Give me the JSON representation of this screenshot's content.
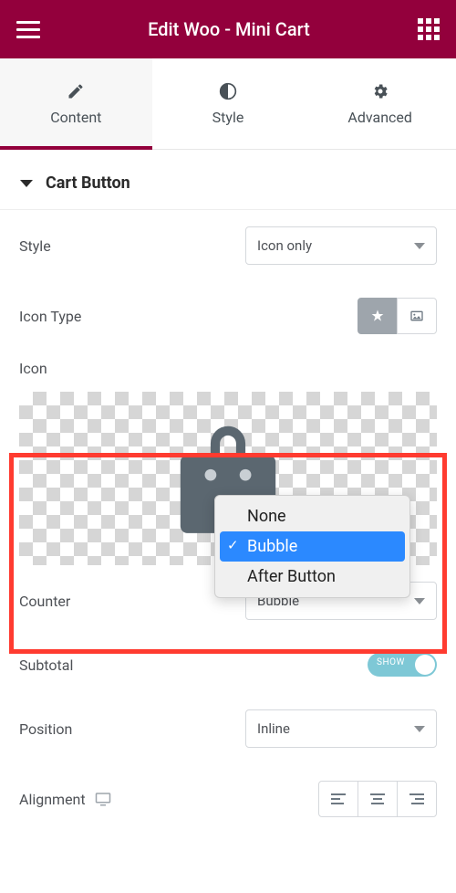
{
  "header": {
    "title": "Edit Woo - Mini Cart"
  },
  "tabs": {
    "content": "Content",
    "style": "Style",
    "advanced": "Advanced",
    "active": "content"
  },
  "section": {
    "title": "Cart Button"
  },
  "controls": {
    "style_label": "Style",
    "style_value": "Icon only",
    "icon_type_label": "Icon Type",
    "icon_label": "Icon",
    "counter_label": "Counter",
    "counter_options": [
      "None",
      "Bubble",
      "After Button"
    ],
    "counter_selected": "Bubble",
    "subtotal_label": "Subtotal",
    "subtotal_toggle": "SHOW",
    "position_label": "Position",
    "position_value": "Inline",
    "alignment_label": "Alignment"
  }
}
